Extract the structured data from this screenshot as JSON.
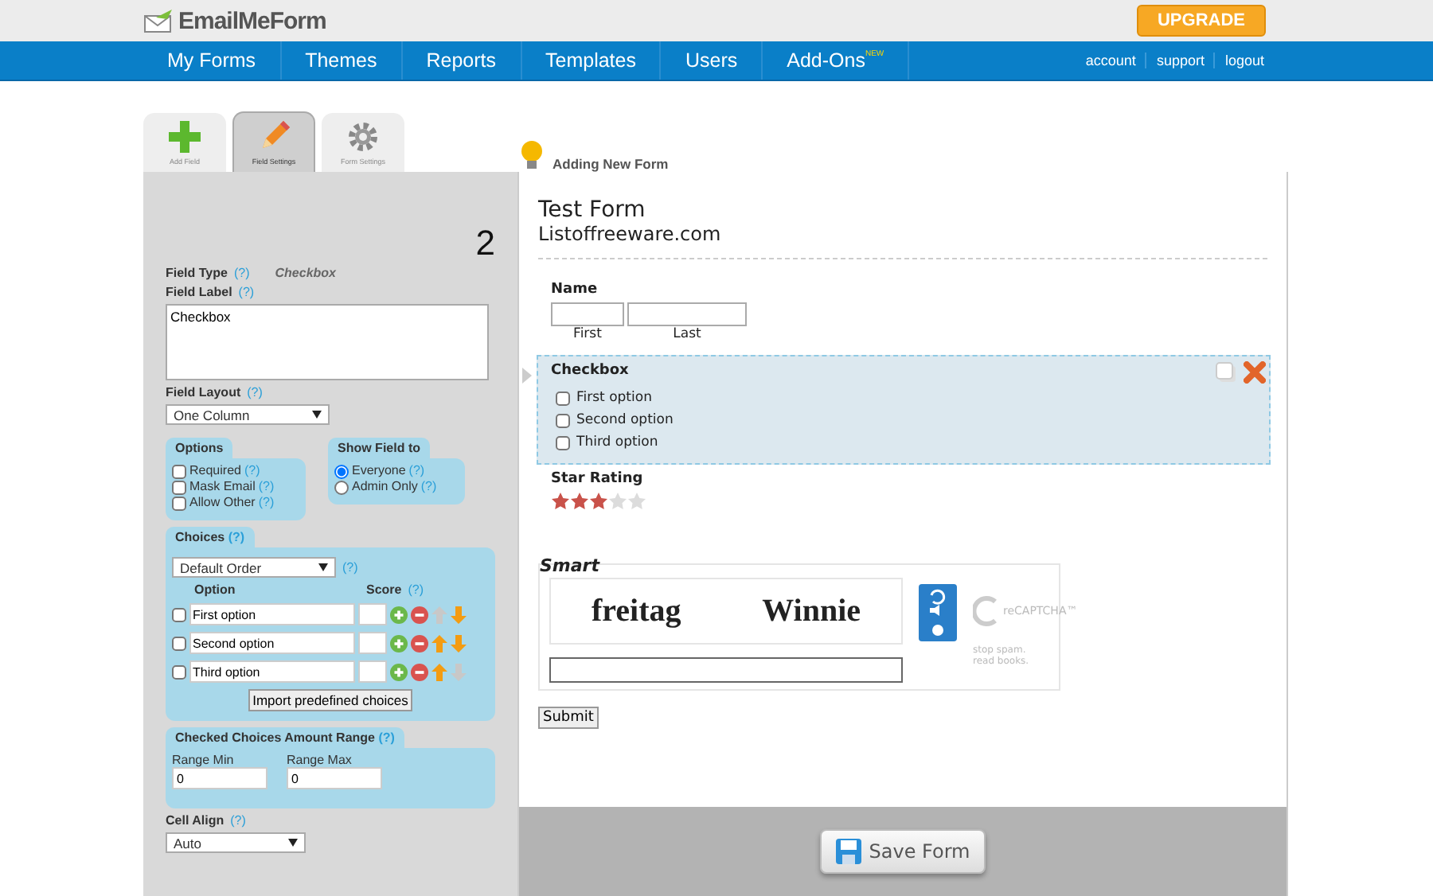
{
  "header": {
    "logo": "EmailMeForm",
    "upgrade": "UPGRADE"
  },
  "nav": {
    "items": [
      {
        "label": "My Forms"
      },
      {
        "label": "Themes"
      },
      {
        "label": "Reports"
      },
      {
        "label": "Templates"
      },
      {
        "label": "Users"
      },
      {
        "label": "Add-Ons",
        "badge": "NEW"
      }
    ],
    "links": [
      "account",
      "support",
      "logout"
    ]
  },
  "tool_tabs": [
    {
      "kind": "add",
      "label": "Add Field",
      "selected": false
    },
    {
      "kind": "edit",
      "label": "Field Settings",
      "selected": true
    },
    {
      "kind": "settings",
      "label": "Form Settings",
      "selected": false
    }
  ],
  "status": "Adding New Form",
  "settings": {
    "step": "2",
    "help": "(?)",
    "field_type_label": "Field Type",
    "field_type": "Checkbox",
    "field_label_label": "Field Label",
    "field_label": "Checkbox",
    "layout_label": "Field Layout",
    "layout": "One Column",
    "options_title": "Options",
    "options": [
      {
        "label": "Required",
        "checked": false
      },
      {
        "label": "Mask Email",
        "checked": false
      },
      {
        "label": "Allow Other",
        "checked": false
      }
    ],
    "show_title": "Show Field to",
    "show": [
      {
        "label": "Everyone",
        "selected": true
      },
      {
        "label": "Admin Only",
        "selected": false
      }
    ],
    "choices_title": "Choices",
    "order": "Default Order",
    "option_col": "Option",
    "score_col": "Score",
    "choices": [
      {
        "label": "First option",
        "checked": false,
        "up": false,
        "down": true
      },
      {
        "label": "Second option",
        "checked": false,
        "up": true,
        "down": true
      },
      {
        "label": "Third option",
        "checked": false,
        "up": true,
        "down": false
      }
    ],
    "import": "Import predefined choices",
    "range_title": "Checked Choices Amount Range",
    "range_min_label": "Range Min",
    "range_min": "0",
    "range_max_label": "Range Max",
    "range_max": "0",
    "align_label": "Cell Align",
    "align": "Auto"
  },
  "form": {
    "title": "Test Form",
    "subtitle": "Listoffreeware.com",
    "name_label": "Name",
    "first": "First",
    "last": "Last",
    "checkbox_label": "Checkbox",
    "checkbox_options": [
      {
        "label": "First option",
        "checked": false
      },
      {
        "label": "Second option",
        "checked": false
      },
      {
        "label": "Third option",
        "checked": false
      }
    ],
    "rating_label": "Star Rating",
    "stars": 3,
    "captcha": {
      "title": "Smart",
      "words": [
        "freitag",
        "Winnie"
      ],
      "brand": "reCAPTCHA™",
      "slogan": "stop spam. read books."
    },
    "submit": "Submit"
  },
  "save": "Save Form"
}
